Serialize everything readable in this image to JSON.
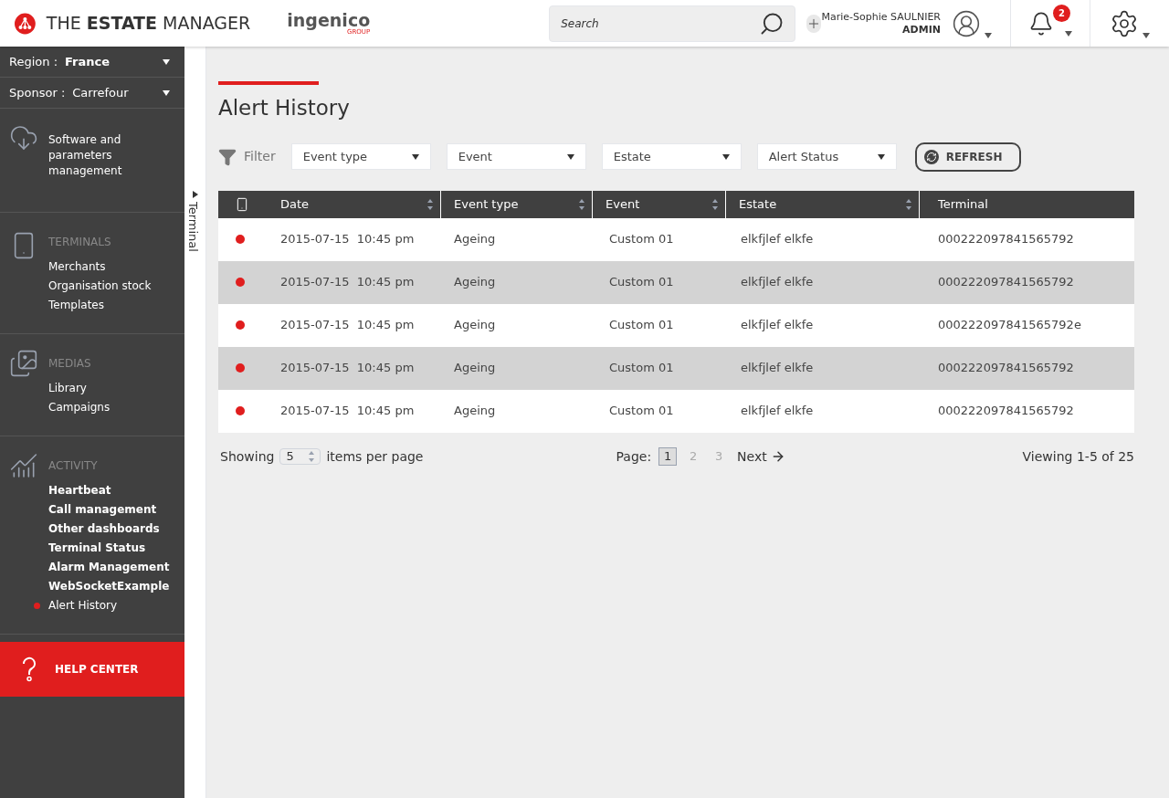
{
  "header": {
    "app_title": "THE **ESTATE** MANAGER",
    "brand": "ingenico",
    "brand_sub": "GROUP",
    "search": {
      "placeholder": "Search"
    },
    "user": {
      "name": "Marie-Sophie SAULNIER",
      "role": "ADMIN"
    },
    "notifications": {
      "count": "2"
    }
  },
  "sidebar": {
    "selectors": [
      {
        "label": "Region :",
        "value": "France",
        "bold": true
      },
      {
        "label": "Sponsor :",
        "value": "Carrefour",
        "bold": false
      }
    ],
    "sections": [
      {
        "kind": "software",
        "title": "Software and parameters management"
      },
      {
        "kind": "terminals",
        "title": "TERMINALS",
        "items": [
          {
            "label": "Merchants",
            "selected": false
          },
          {
            "label": "Organisation stock",
            "selected": false
          },
          {
            "label": "Templates",
            "selected": false
          }
        ]
      },
      {
        "kind": "medias",
        "title": "MEDIAS",
        "items": [
          {
            "label": "Library",
            "selected": false
          },
          {
            "label": "Campaigns",
            "selected": false
          }
        ]
      },
      {
        "kind": "activity",
        "title": "ACTIVITY",
        "items": [
          {
            "label": "Heartbeat",
            "selected": false
          },
          {
            "label": "Call management",
            "selected": false
          },
          {
            "label": "Other dashboards",
            "selected": false
          },
          {
            "label": "Terminal Status",
            "selected": false
          },
          {
            "label": "Alarm Management",
            "selected": false
          },
          {
            "label": "WebSocketExample",
            "selected": false
          },
          {
            "label": "Alert History",
            "selected": true
          }
        ]
      }
    ],
    "help": "HELP CENTER"
  },
  "side_panel": {
    "label": "Terminal",
    "expanded": false
  },
  "main": {
    "title": "Alert History",
    "filter_label": "Filter",
    "filters": [
      "Event type",
      "Event",
      "Estate",
      "Alert Status"
    ],
    "refresh": "REFRESH",
    "table": {
      "columns": [
        {
          "label": "Date",
          "sortable": true
        },
        {
          "label": "Event type",
          "sortable": true
        },
        {
          "label": "Event",
          "sortable": true
        },
        {
          "label": "Estate",
          "sortable": true
        },
        {
          "label": "Terminal",
          "sortable": false
        }
      ],
      "rows": [
        {
          "color": "#e01e1e",
          "cells": [
            "2015-07-15  10:45 pm",
            "Ageing",
            "Custom 01",
            "elkfjlef elkfe",
            "000222097841565792"
          ]
        },
        {
          "color": "#e01e1e",
          "cells": [
            "2015-07-15  10:45 pm",
            "Ageing",
            "Custom 01",
            "elkfjlef elkfe",
            "000222097841565792"
          ]
        },
        {
          "color": "#e01e1e",
          "cells": [
            "2015-07-15  10:45 pm",
            "Ageing",
            "Custom 01",
            "elkfjlef elkfe",
            "000222097841565792e"
          ]
        },
        {
          "color": "#e01e1e",
          "cells": [
            "2015-07-15  10:45 pm",
            "Ageing",
            "Custom 01",
            "elkfjlef elkfe",
            "000222097841565792"
          ]
        },
        {
          "color": "#e01e1e",
          "cells": [
            "2015-07-15  10:45 pm",
            "Ageing",
            "Custom 01",
            "elkfjlef elkfe",
            "000222097841565792"
          ]
        }
      ]
    },
    "pagination": {
      "showing": "Showing",
      "per_page": "5",
      "per_page_suffix": "items per page",
      "page_label": "Page:",
      "pages": [
        {
          "label": "1",
          "selected": true
        },
        {
          "label": "2",
          "selected": false
        },
        {
          "label": "3",
          "selected": false
        }
      ],
      "next": "Next",
      "viewing": "Viewing 1-5 of 25"
    }
  }
}
